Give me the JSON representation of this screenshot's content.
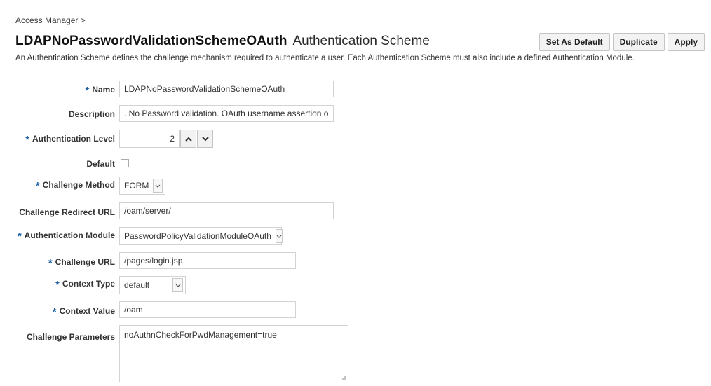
{
  "breadcrumb": "Access Manager >",
  "header": {
    "title": "LDAPNoPasswordValidationSchemeOAuth",
    "subtitle": "Authentication Scheme",
    "buttons": {
      "set_default": "Set As Default",
      "duplicate": "Duplicate",
      "apply": "Apply"
    }
  },
  "description": "An Authentication Scheme defines the challenge mechanism required to authenticate a user. Each Authentication Scheme must also include a defined Authentication Module.",
  "required_marker": "*",
  "form": {
    "name": {
      "label": "Name",
      "value": "LDAPNoPasswordValidationSchemeOAuth"
    },
    "description": {
      "label": "Description",
      "value": ". No Password validation. OAuth username assertion only."
    },
    "auth_level": {
      "label": "Authentication Level",
      "value": "2"
    },
    "default": {
      "label": "Default",
      "checked": false
    },
    "challenge_method": {
      "label": "Challenge Method",
      "value": "FORM"
    },
    "challenge_redirect_url": {
      "label": "Challenge Redirect URL",
      "value": "/oam/server/"
    },
    "auth_module": {
      "label": "Authentication Module",
      "value": "PasswordPolicyValidationModuleOAuth"
    },
    "challenge_url": {
      "label": "Challenge URL",
      "value": "/pages/login.jsp"
    },
    "context_type": {
      "label": "Context Type",
      "value": "default"
    },
    "context_value": {
      "label": "Context Value",
      "value": "/oam"
    },
    "challenge_parameters": {
      "label": "Challenge Parameters",
      "value": "noAuthnCheckForPwdManagement=true"
    }
  },
  "icons": {
    "up": "chevron-up-icon",
    "down": "chevron-down-icon",
    "dropdown": "dropdown-caret-icon",
    "resize": "resize-grip-icon"
  },
  "colors": {
    "required": "#1a5fa6",
    "border": "#d3d3d3",
    "button_bg": "#f3f3f3"
  }
}
